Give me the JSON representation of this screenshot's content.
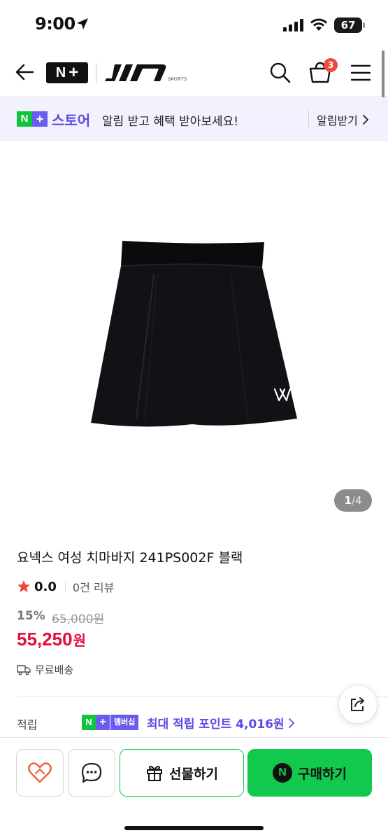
{
  "status_bar": {
    "time": "9:00",
    "battery": "67"
  },
  "header": {
    "brand_sub": "SPORTS",
    "cart_count": "3",
    "icons": [
      "back-arrow-icon",
      "search-icon",
      "cart-icon",
      "menu-icon"
    ]
  },
  "promo": {
    "store_label": "스토어",
    "message": "알림 받고 혜택 받아보세요!",
    "alarm_button": "알림받기"
  },
  "gallery": {
    "current": "1",
    "total": "/4"
  },
  "product": {
    "title": "요넥스 여성 치마바지 241PS002F 블랙",
    "rating": "0.0",
    "reviews": "0건 리뷰",
    "discount": "15%",
    "original_price": "65,000원",
    "price": "55,250",
    "price_unit": "원",
    "shipping": "무료배송"
  },
  "points": {
    "label": "적립",
    "badge": "멤버십",
    "text": "최대 적립 포인트 4,016원"
  },
  "bottom_bar": {
    "gift_label": "선물하기",
    "buy_label": "구매하기",
    "n_mark": "N"
  },
  "colors": {
    "naver_green": "#12c94d",
    "purple": "#5a4be6",
    "price_red": "#e0103a"
  }
}
